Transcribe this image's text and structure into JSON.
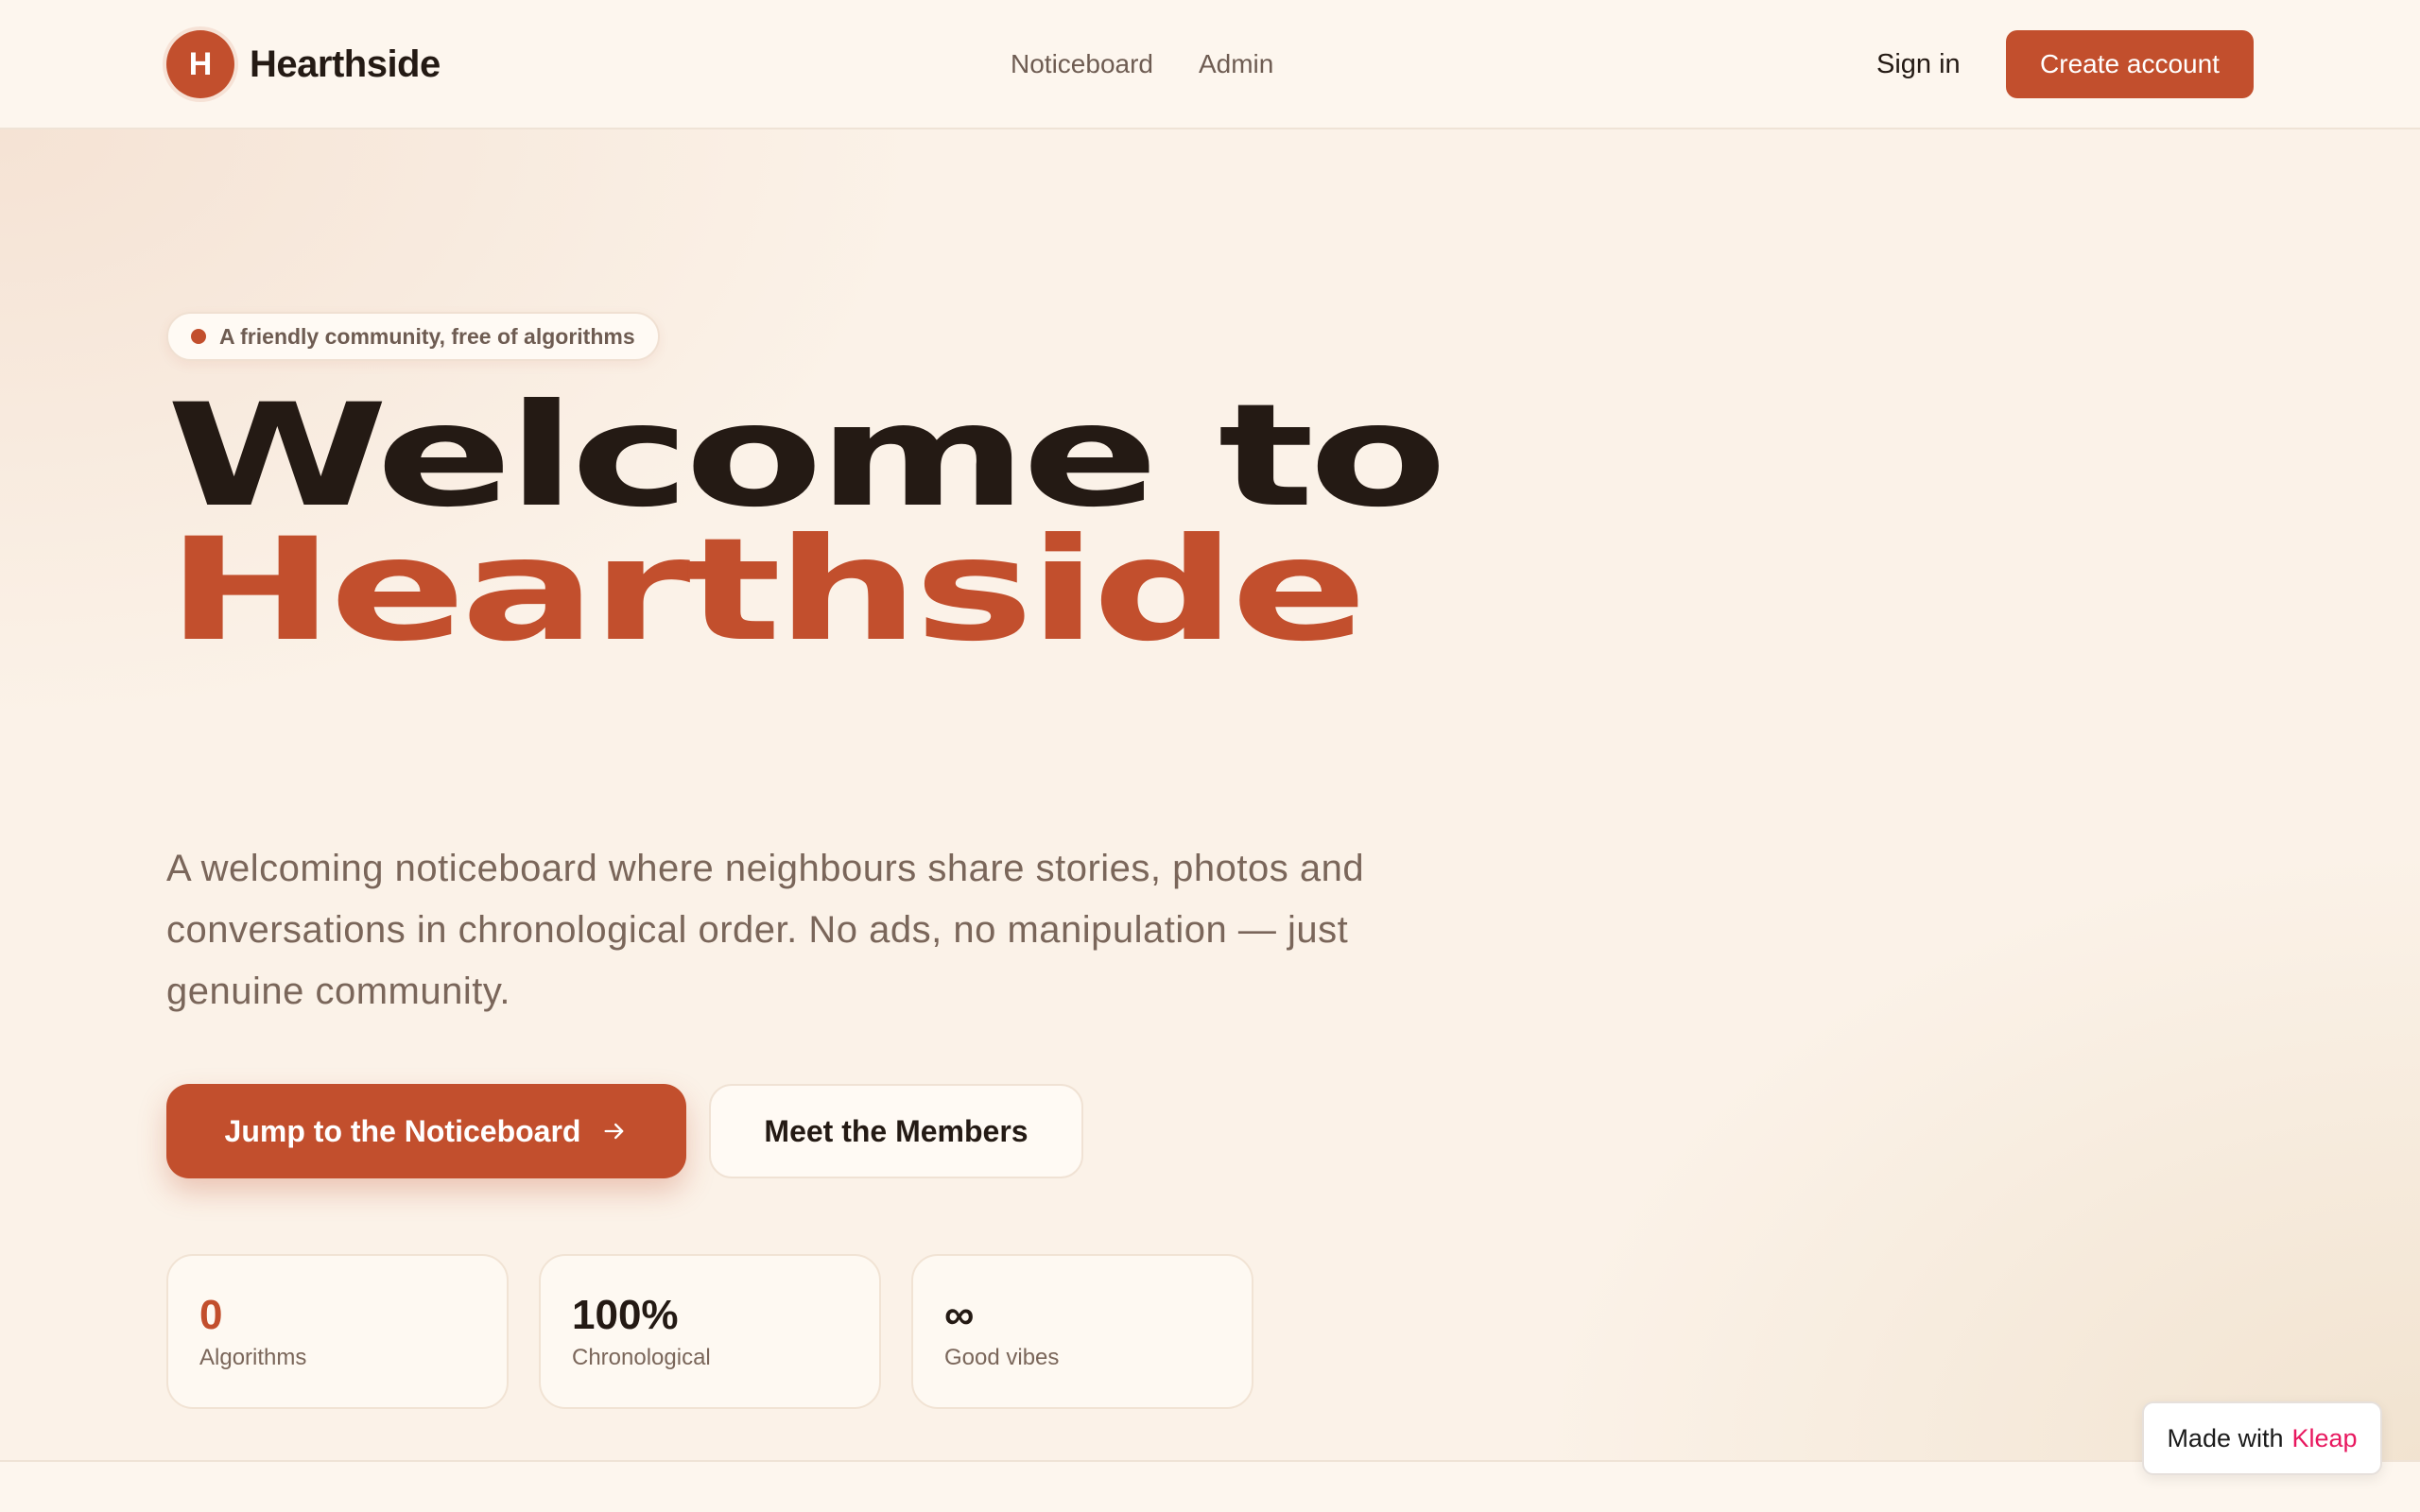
{
  "header": {
    "logo_letter": "H",
    "brand_name": "Hearthside",
    "nav": [
      {
        "label": "Noticeboard"
      },
      {
        "label": "Admin"
      }
    ],
    "sign_in_label": "Sign in",
    "create_account_label": "Create account"
  },
  "hero": {
    "pill_text": "A friendly community, free of algorithms",
    "headline_line1": "Welcome to",
    "headline_line2": "Hearthside",
    "lead": "A welcoming noticeboard where neighbours share stories, photos and conversations in chronological order. No ads, no manipulation — just genuine community.",
    "primary_cta_label": "Jump to the Noticeboard",
    "primary_cta_icon": "arrow-right-icon",
    "secondary_cta_label": "Meet the Members",
    "stats": [
      {
        "value": "0",
        "label": "Algorithms"
      },
      {
        "value": "100%",
        "label": "Chronological"
      },
      {
        "value": "∞",
        "label": "Good vibes"
      }
    ]
  },
  "badge": {
    "prefix": "Made with",
    "brand": "Kleap"
  },
  "colors": {
    "accent": "#c24f2d",
    "text_dark": "#241a14",
    "text_muted": "#7a665a",
    "background": "#fbf2e8",
    "badge_brand": "#e8185f"
  }
}
